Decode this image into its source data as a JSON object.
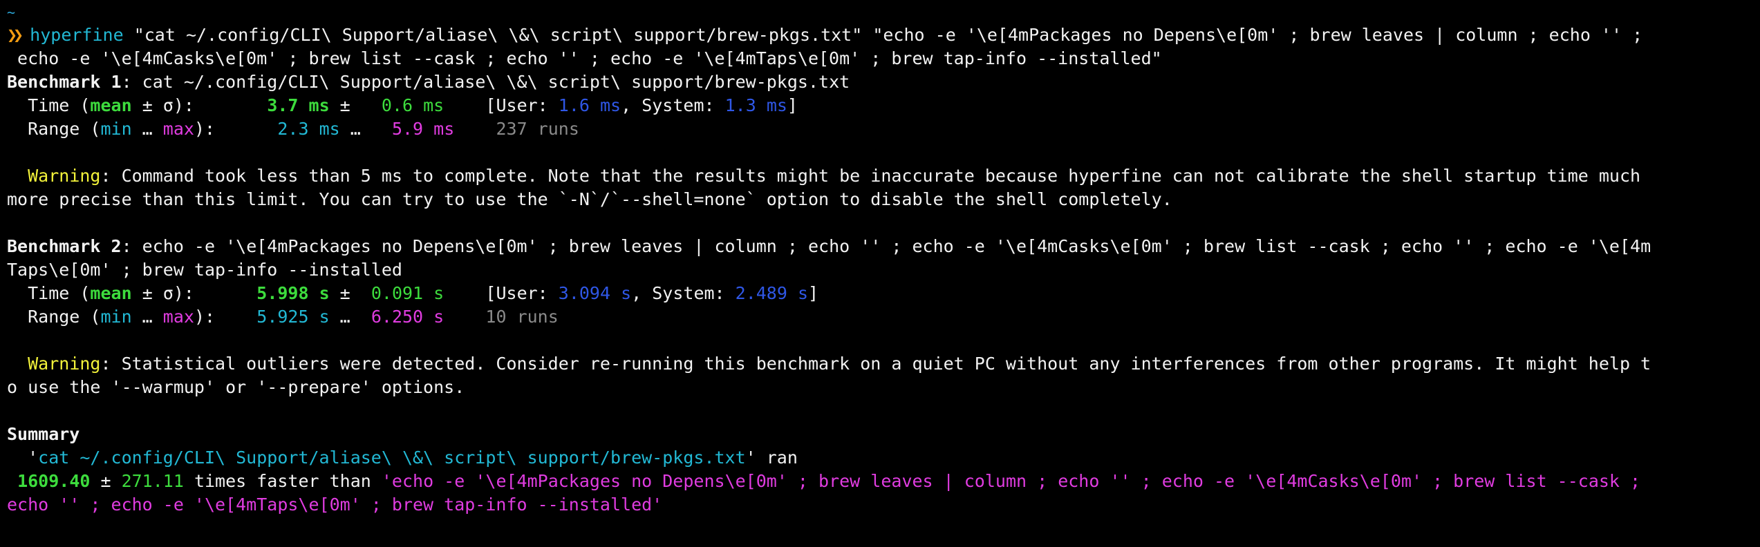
{
  "prompt": {
    "cwd": "~",
    "symbol": "❯❯",
    "command": "hyperfine",
    "arg1": " \"cat ~/.config/CLI\\ Support/aliase\\ \\&\\ script\\ support/brew-pkgs.txt\" \"echo -e '\\e[4mPackages no Depens\\e[0m' ; brew leaves | column ; echo '' ;",
    "arg1_cont": " echo -e '\\e[4mCasks\\e[0m' ; brew list --cask ; echo '' ; echo -e '\\e[4mTaps\\e[0m' ; brew tap-info --installed\""
  },
  "bench1": {
    "heading": "Benchmark 1",
    "cmd": ": cat ~/.config/CLI\\ Support/aliase\\ \\&\\ script\\ support/brew-pkgs.txt",
    "time_label_pre": "  Time (",
    "mean": "mean",
    "pm_sigma": " ± σ):",
    "time_mean": "3.7 ms",
    "pm": " ±",
    "time_sigma": "0.6 ms",
    "user_label": "[User: ",
    "user_val": "1.6 ms",
    "sys_label": ", System: ",
    "sys_val": "1.3 ms",
    "close_bracket": "]",
    "range_label_pre": "  Range (",
    "min": "min",
    "ellipsis": " … ",
    "max": "max",
    "range_close": "):",
    "range_min": "2.3 ms",
    "range_ellipsis": " …",
    "range_max": "5.9 ms",
    "runs": "237 runs",
    "warning_label": "Warning",
    "warning_line1": ": Command took less than 5 ms to complete. Note that the results might be inaccurate because hyperfine can not calibrate the shell startup time much",
    "warning_line2": "more precise than this limit. You can try to use the `-N`/`--shell=none` option to disable the shell completely."
  },
  "bench2": {
    "heading": "Benchmark 2",
    "cmd_line1": ": echo -e '\\e[4mPackages no Depens\\e[0m' ; brew leaves | column ; echo '' ; echo -e '\\e[4mCasks\\e[0m' ; brew list --cask ; echo '' ; echo -e '\\e[4m",
    "cmd_line2": "Taps\\e[0m' ; brew tap-info --installed",
    "time_mean": "5.998 s",
    "time_sigma": "0.091 s",
    "user_val": "3.094 s",
    "sys_val": "2.489 s",
    "range_min": "5.925 s",
    "range_max": "6.250 s",
    "runs": "10 runs",
    "warning_label": "Warning",
    "warning_line1": ": Statistical outliers were detected. Consider re-running this benchmark on a quiet PC without any interferences from other programs. It might help t",
    "warning_line2": "o use the '--warmup' or '--prepare' options."
  },
  "summary": {
    "heading": "Summary",
    "quote_open": "  '",
    "fastest_cmd": "cat ~/.config/CLI\\ Support/aliase\\ \\&\\ script\\ support/brew-pkgs.txt",
    "ran": "' ran",
    "factor": "1609.40",
    "pm": " ± ",
    "factor_err": "271.11",
    "faster_than": " times faster than ",
    "slow_cmd_line1": "'echo -e '\\e[4mPackages no Depens\\e[0m' ; brew leaves | column ; echo '' ; echo -e '\\e[4mCasks\\e[0m' ; brew list --cask ;",
    "slow_cmd_line2": "echo '' ; echo -e '\\e[4mTaps\\e[0m' ; brew tap-info --installed'"
  }
}
